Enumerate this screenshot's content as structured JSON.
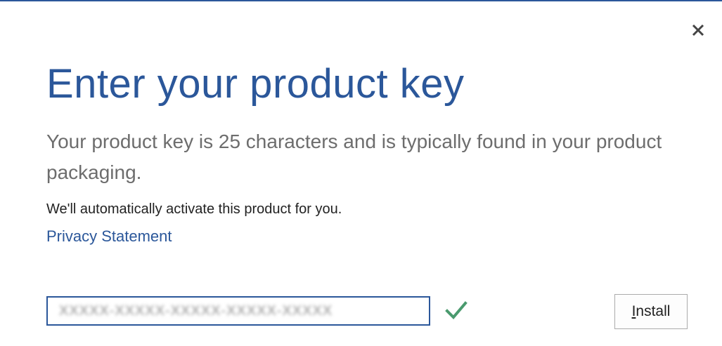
{
  "dialog": {
    "title": "Enter your product key",
    "description": "Your product key is 25 characters and is typically found in your product packaging.",
    "auto_activate_text": "We'll automatically activate this product for you.",
    "privacy_link": "Privacy Statement",
    "close_icon": "close-icon",
    "product_key_input": {
      "value": "XXXXX-XXXXX-XXXXX-XXXXX-XXXXX",
      "placeholder": ""
    },
    "validation_icon": "checkmark-icon",
    "install_button": {
      "mnemonic": "I",
      "rest": "nstall"
    }
  },
  "colors": {
    "accent": "#2b579a",
    "check": "#4a9a6e",
    "description_text": "#6d6d6d",
    "close": "#444444"
  }
}
